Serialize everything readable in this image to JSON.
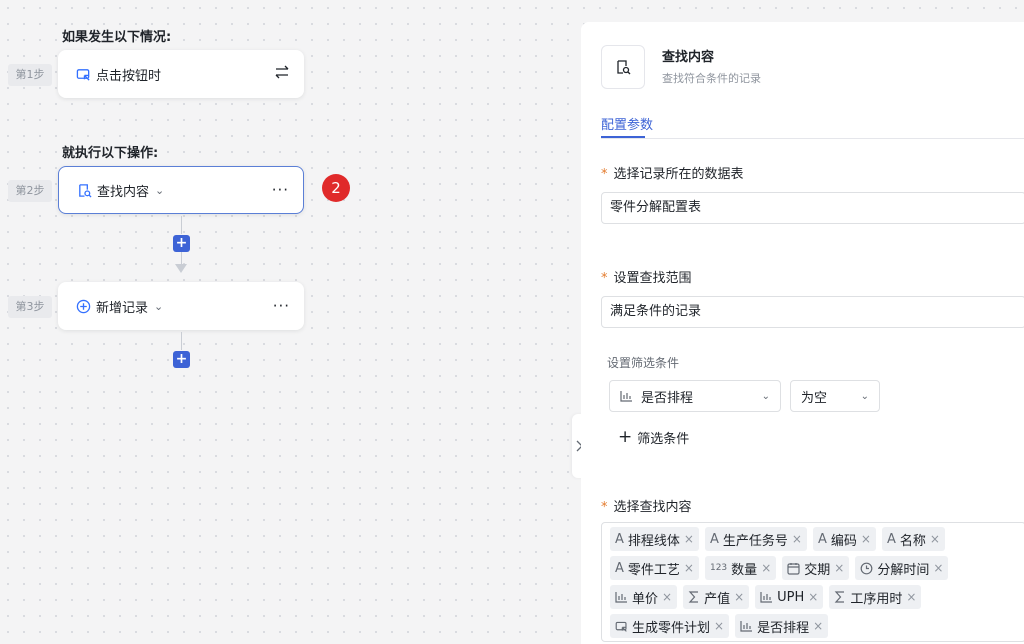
{
  "trigger": {
    "heading": "如果发生以下情况:",
    "step_label": "第1步",
    "card_title": "点击按钮时"
  },
  "actions": {
    "heading": "就执行以下操作:",
    "steps": [
      {
        "label": "第2步",
        "title": "查找内容"
      },
      {
        "label": "第3步",
        "title": "新增记录"
      }
    ],
    "more": "···",
    "plus": "+"
  },
  "badge": "2",
  "panel": {
    "title": "查找内容",
    "subtitle": "查找符合条件的记录",
    "tab": "配置参数",
    "required_mark": "*",
    "table_label": "选择记录所在的数据表",
    "table_value": "零件分解配置表",
    "scope_label": "设置查找范围",
    "scope_value": "满足条件的记录",
    "filter_label": "设置筛选条件",
    "filter_field": "是否排程",
    "filter_op": "为空",
    "add_filter": "筛选条件",
    "content_label": "选择查找内容",
    "tag_rows": [
      [
        {
          "icon": "A",
          "label": "排程线体"
        },
        {
          "icon": "A",
          "label": "生产任务号"
        },
        {
          "icon": "A",
          "label": "编码"
        },
        {
          "icon": "A",
          "label": "名称"
        }
      ],
      [
        {
          "icon": "A",
          "label": "零件工艺"
        },
        {
          "icon": "123",
          "label": "数量"
        },
        {
          "icon": "calendar",
          "label": "交期"
        },
        {
          "icon": "clock",
          "label": "分解时间"
        }
      ],
      [
        {
          "icon": "bars",
          "label": "单价"
        },
        {
          "icon": "sigma",
          "label": "产值"
        },
        {
          "icon": "bars",
          "label": "UPH"
        },
        {
          "icon": "sigma",
          "label": "工序用时"
        }
      ],
      [
        {
          "icon": "button",
          "label": "生成零件计划"
        },
        {
          "icon": "bars",
          "label": "是否排程"
        }
      ]
    ]
  },
  "colors": {
    "accent": "#3d63d6",
    "badge": "#e02a2a",
    "required": "#e37a2c"
  }
}
